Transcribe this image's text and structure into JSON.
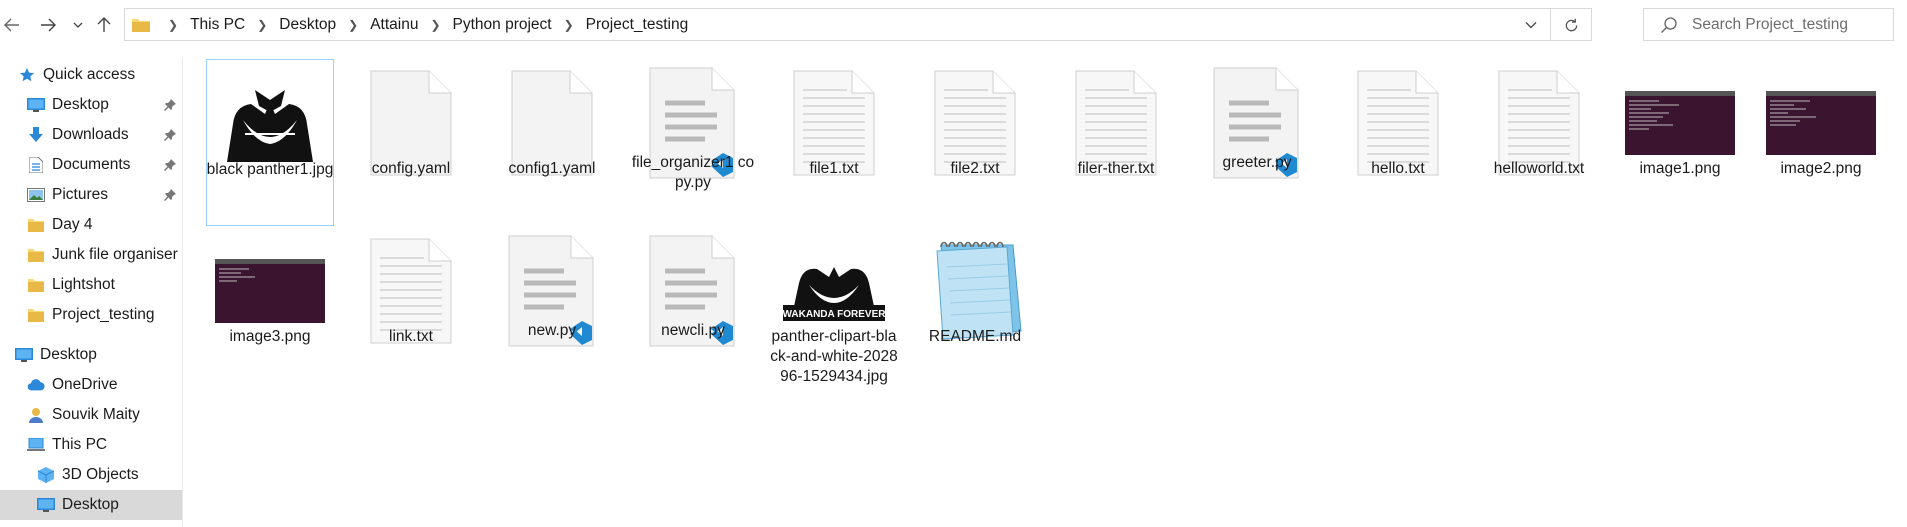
{
  "breadcrumb": [
    "This PC",
    "Desktop",
    "Attainu",
    "Python project",
    "Project_testing"
  ],
  "search": {
    "placeholder": "Search Project_testing"
  },
  "sidebar": {
    "items": [
      {
        "label": "Quick access",
        "icon": "star-icon",
        "pinned": false
      },
      {
        "label": "Desktop",
        "icon": "desktop-icon",
        "pinned": true
      },
      {
        "label": "Downloads",
        "icon": "download-icon",
        "pinned": true
      },
      {
        "label": "Documents",
        "icon": "documents-icon",
        "pinned": true
      },
      {
        "label": "Pictures",
        "icon": "pictures-icon",
        "pinned": true
      },
      {
        "label": "Day 4",
        "icon": "folder-icon",
        "pinned": false
      },
      {
        "label": "Junk file organiser",
        "icon": "folder-icon",
        "pinned": false
      },
      {
        "label": "Lightshot",
        "icon": "folder-icon",
        "pinned": false
      },
      {
        "label": "Project_testing",
        "icon": "folder-icon",
        "pinned": false
      },
      {
        "label": "Desktop",
        "icon": "desktop-icon",
        "pinned": false
      },
      {
        "label": "OneDrive",
        "icon": "cloud-icon",
        "pinned": false
      },
      {
        "label": "Souvik Maity",
        "icon": "user-icon",
        "pinned": false
      },
      {
        "label": "This PC",
        "icon": "computer-icon",
        "pinned": false
      },
      {
        "label": "3D Objects",
        "icon": "cube-icon",
        "pinned": false
      },
      {
        "label": "Desktop",
        "icon": "desktop-icon",
        "pinned": false
      }
    ]
  },
  "files": [
    {
      "name": "black panther1.jpg",
      "type": "jpg-panther"
    },
    {
      "name": "config.yaml",
      "type": "blank"
    },
    {
      "name": "config1.yaml",
      "type": "blank"
    },
    {
      "name": "file_organizer1 copy.py",
      "type": "py"
    },
    {
      "name": "file1.txt",
      "type": "txt"
    },
    {
      "name": "file2.txt",
      "type": "txt"
    },
    {
      "name": "filer-ther.txt",
      "type": "txt"
    },
    {
      "name": "greeter.py",
      "type": "py"
    },
    {
      "name": "hello.txt",
      "type": "txt"
    },
    {
      "name": "helloworld.txt",
      "type": "txt"
    },
    {
      "name": "image1.png",
      "type": "png-terminal"
    },
    {
      "name": "image2.png",
      "type": "png-terminal"
    },
    {
      "name": "image3.png",
      "type": "png-terminal"
    },
    {
      "name": "link.txt",
      "type": "txt"
    },
    {
      "name": "new.py",
      "type": "py"
    },
    {
      "name": "newcli.py",
      "type": "py"
    },
    {
      "name": "panther-clipart-black-and-white-202896-1529434.jpg",
      "type": "jpg-wakanda"
    },
    {
      "name": "README.md",
      "type": "notepad"
    }
  ],
  "wakanda_text": "WAKANDA FOREVER",
  "colors": {
    "selection": "#cce8ff",
    "hover": "#d9d9d9",
    "vscode_blue": "#1f8ad2",
    "folder_yellow": "#f8d775"
  }
}
